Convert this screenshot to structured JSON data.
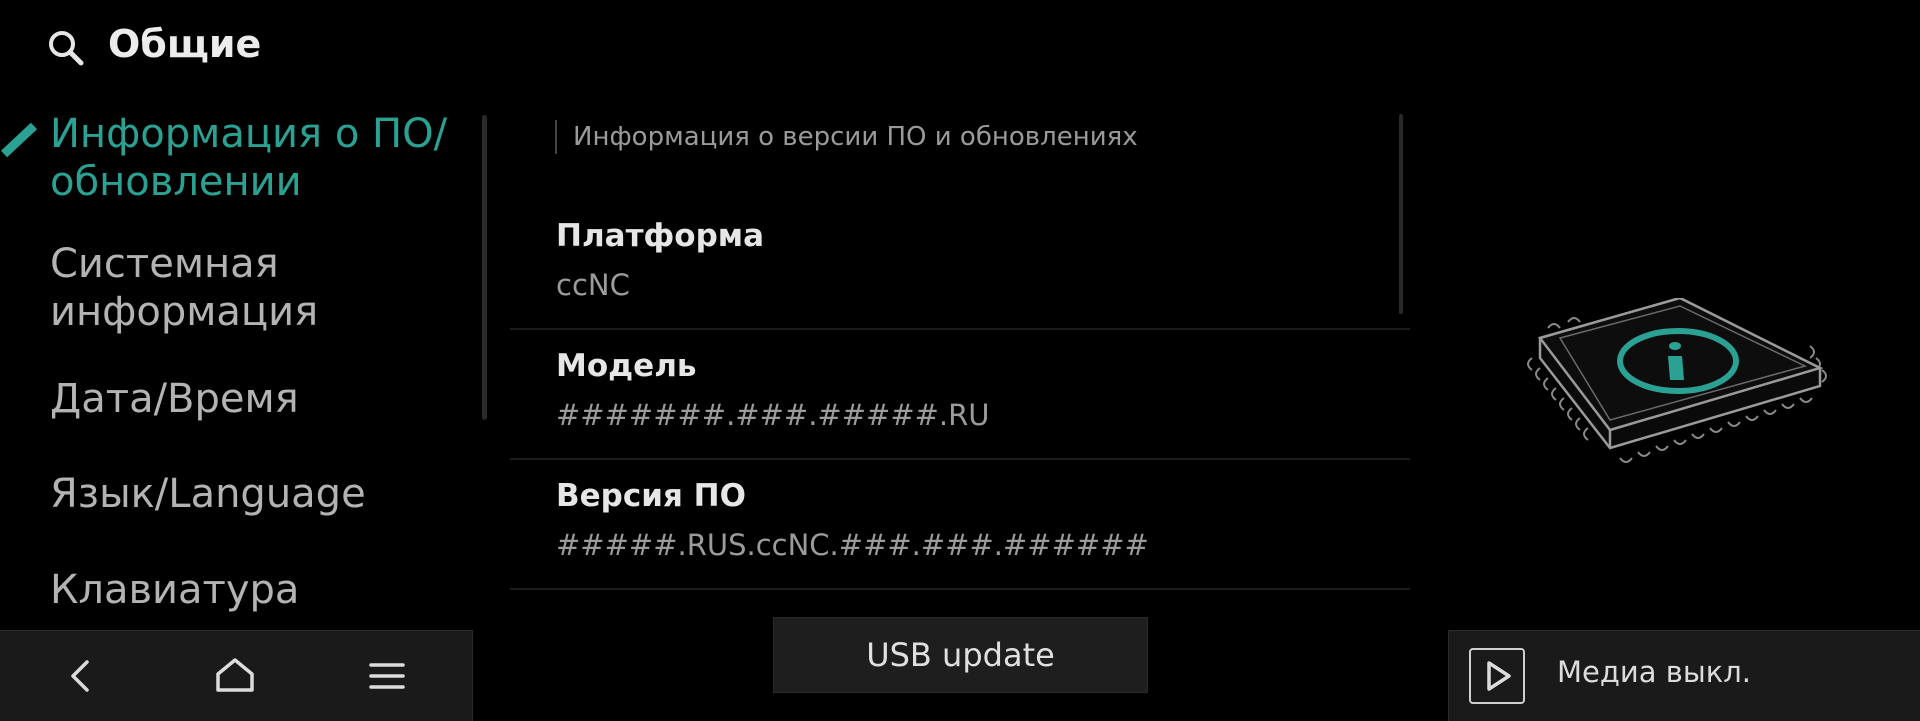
{
  "header": {
    "title": "Общие"
  },
  "sidebar": {
    "items": [
      {
        "label": "Информация о ПО/ обновлении",
        "active": true
      },
      {
        "label": "Системная информация",
        "active": false
      },
      {
        "label": "Дата/Время",
        "active": false
      },
      {
        "label": "Язык/Language",
        "active": false
      },
      {
        "label": "Клавиатура",
        "active": false
      }
    ]
  },
  "content": {
    "section_title": "Информация о версии ПО и обновлениях",
    "rows": [
      {
        "label": "Платформа",
        "value": "ccNC"
      },
      {
        "label": "Модель",
        "value": "#######.###.#####.RU"
      },
      {
        "label": "Версия ПО",
        "value": "#####.RUS.ccNC.###.###.######"
      }
    ]
  },
  "usb_button": {
    "label": "USB update"
  },
  "media": {
    "label": "Медиа выкл."
  },
  "colors": {
    "accent": "#2aa192",
    "background": "#000000",
    "panel": "#1a1a1a"
  },
  "icons": {
    "search": "search-icon",
    "back": "back-icon",
    "home": "home-icon",
    "menu": "menu-icon",
    "play": "play-icon",
    "chip": "chip-info-icon"
  }
}
